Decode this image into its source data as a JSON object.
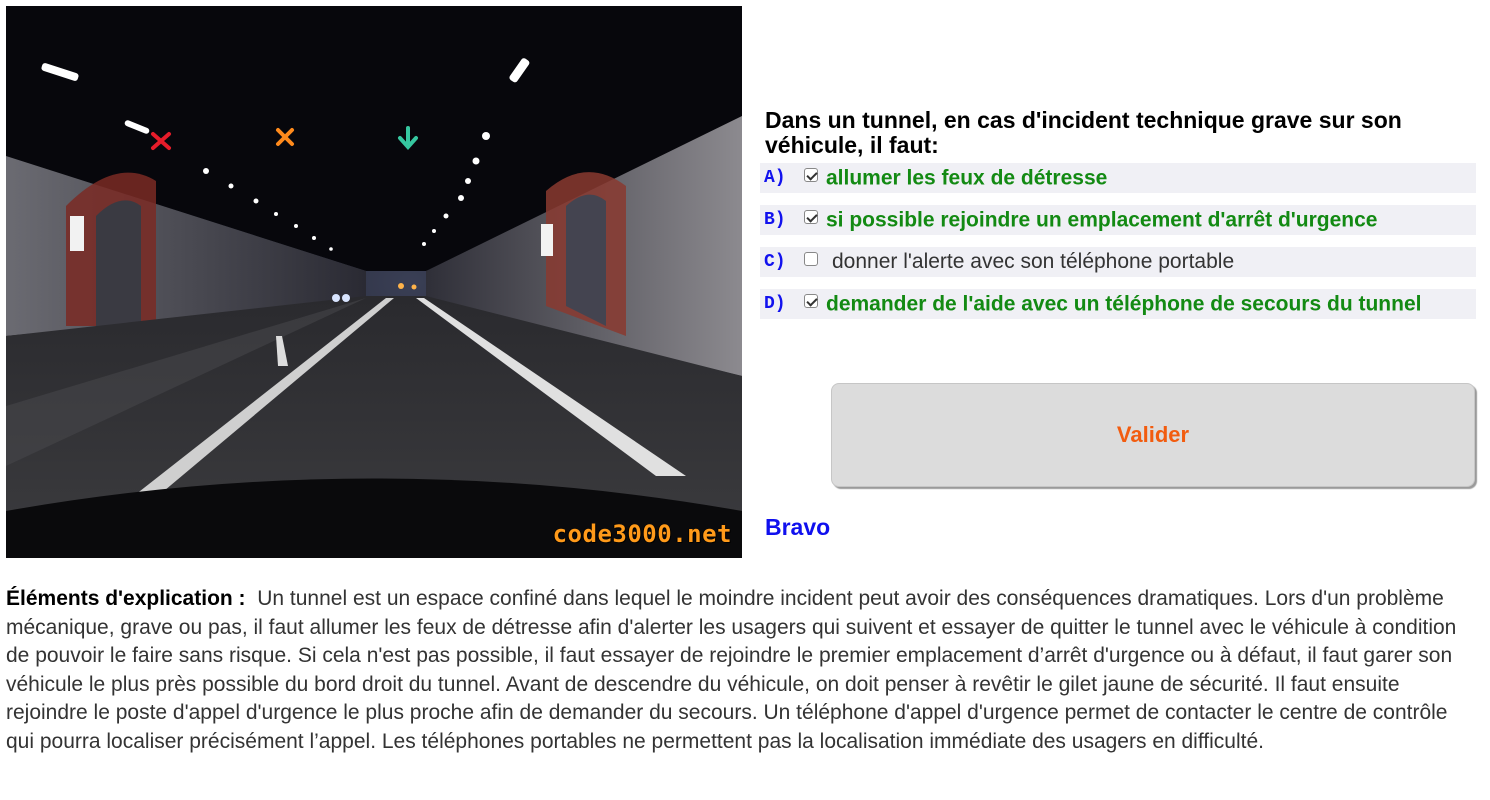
{
  "photo": {
    "description_icon": "tunnel-photo",
    "watermark": "code3000.net",
    "lane_signals": [
      "red-x-icon",
      "orange-x-icon",
      "green-arrow-down-icon"
    ]
  },
  "question": {
    "text": "Dans un tunnel, en cas d'incident technique grave sur son véhicule, il faut:"
  },
  "answers": [
    {
      "letter": "A)",
      "text": "allumer les feux de détresse",
      "checked": true,
      "style": "correct"
    },
    {
      "letter": "B)",
      "text": "si possible rejoindre un emplacement d'arrêt d'urgence",
      "checked": true,
      "style": "correct"
    },
    {
      "letter": "C)",
      "text": "donner l'alerte avec son téléphone portable",
      "checked": false,
      "style": "neutral"
    },
    {
      "letter": "D)",
      "text": "demander de l'aide avec un téléphone de secours du tunnel",
      "checked": true,
      "style": "correct"
    }
  ],
  "actions": {
    "validate_label": "Valider"
  },
  "result": {
    "message": "Bravo"
  },
  "explanation": {
    "lead": "Éléments d'explication :",
    "body": "Un tunnel est un espace confiné dans lequel le moindre incident peut avoir des conséquences dramatiques. Lors d'un problème mécanique, grave ou pas, il faut allumer les feux de détresse afin d'alerter les usagers qui suivent et essayer de quitter le tunnel avec le véhicule à condition de pouvoir le faire sans risque. Si cela n'est pas possible, il faut essayer de rejoindre le premier emplacement d’arrêt d'urgence ou à défaut, il faut garer son véhicule le plus près possible du bord droit du tunnel. Avant de descendre du véhicule, on doit penser à revêtir le gilet jaune de sécurité. Il faut ensuite rejoindre le poste d'appel d'urgence le plus proche afin de demander du secours. Un téléphone d'appel d'urgence permet de contacter le centre de contrôle qui pourra localiser précisément l’appel. Les téléphones portables ne permettent pas la localisation immédiate des usagers en difficulté."
  },
  "colors": {
    "correct": "#138a13",
    "letter": "#1212ee",
    "validate_text": "#f25c0f",
    "bravo": "#1010ee",
    "answer_bg": "#f0f0f5"
  }
}
